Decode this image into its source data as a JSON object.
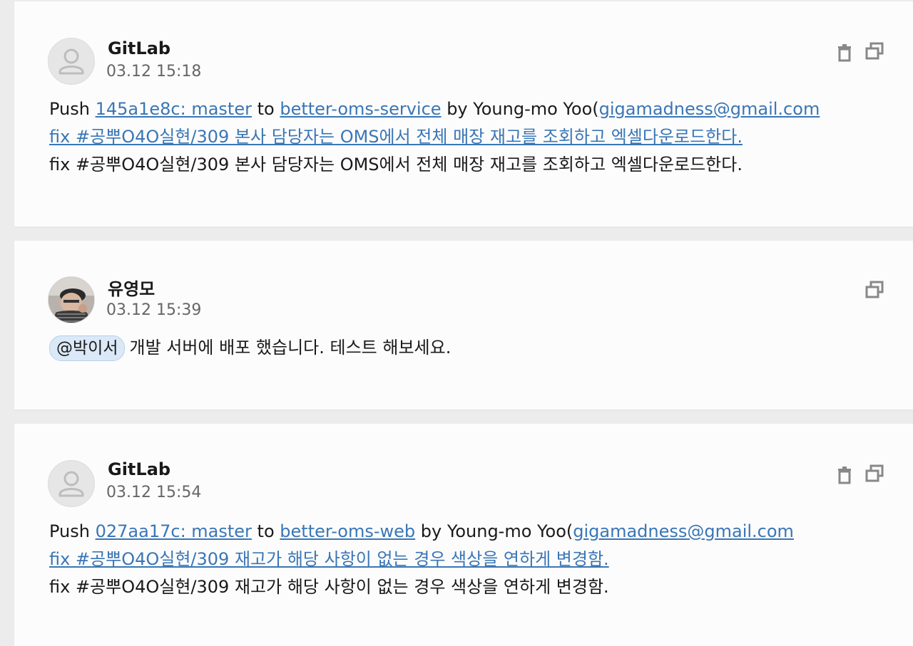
{
  "messages": [
    {
      "author": "GitLab",
      "time": "03.12 15:18",
      "avatar_icon": "default-user-icon",
      "push_prefix": "Push ",
      "commit_link": "145a1e8c: master",
      "to_text": " to ",
      "repo_link": "better-oms-service",
      "by_text": " by Young-mo Yoo(",
      "email_link": "gigamadness@gmail.com",
      "commit_title_link": "fix #공뿌O4O실현/309 본사 담당자는 OMS에서 전체 매장 재고를 조회하고 엑셀다운로드한다.",
      "commit_message": "fix #공뿌O4O실현/309 본사 담당자는 OMS에서 전체 매장 재고를 조회하고 엑셀다운로드한다.",
      "actions": [
        "trash-icon",
        "copy-icon"
      ]
    },
    {
      "author": "유영모",
      "time": "03.12 15:39",
      "avatar_icon": "profile-photo",
      "mention": "@박이서",
      "text": "개발 서버에 배포 했습니다. 테스트 해보세요.",
      "actions": [
        "copy-icon"
      ]
    },
    {
      "author": "GitLab",
      "time": "03.12 15:54",
      "avatar_icon": "default-user-icon",
      "push_prefix": "Push ",
      "commit_link": "027aa17c: master",
      "to_text": " to ",
      "repo_link": "better-oms-web",
      "by_text": " by Young-mo Yoo(",
      "email_link": "gigamadness@gmail.com",
      "commit_title_link": "fix #공뿌O4O실현/309 재고가 해당 사항이 없는 경우 색상을 연하게 변경함.",
      "commit_message": "fix #공뿌O4O실현/309 재고가 해당 사항이 없는 경우 색상을 연하게 변경함.",
      "actions": [
        "trash-icon",
        "copy-icon"
      ]
    }
  ],
  "colors": {
    "link": "#3a76b6",
    "mention_bg": "#dbe8f7",
    "background": "#ececec",
    "card": "#fcfcfc"
  }
}
